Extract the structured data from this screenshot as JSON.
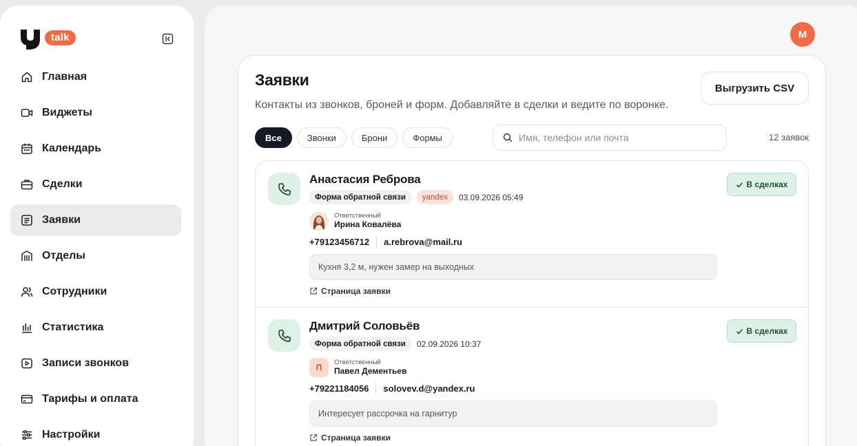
{
  "brand": {
    "logo_text": "talk",
    "accent": "#f26a45"
  },
  "sidebar": {
    "items": [
      {
        "label": "Главная",
        "icon": "home-icon",
        "active": false
      },
      {
        "label": "Виджеты",
        "icon": "video-icon",
        "active": false
      },
      {
        "label": "Календарь",
        "icon": "calendar-icon",
        "active": false
      },
      {
        "label": "Сделки",
        "icon": "briefcase-icon",
        "active": false
      },
      {
        "label": "Заявки",
        "icon": "list-icon",
        "active": true
      },
      {
        "label": "Отделы",
        "icon": "building-icon",
        "active": false
      },
      {
        "label": "Сотрудники",
        "icon": "users-icon",
        "active": false
      },
      {
        "label": "Статистика",
        "icon": "chart-icon",
        "active": false
      },
      {
        "label": "Записи звонков",
        "icon": "play-icon",
        "active": false
      },
      {
        "label": "Тарифы и оплата",
        "icon": "card-icon",
        "active": false
      },
      {
        "label": "Настройки",
        "icon": "sliders-icon",
        "active": false
      }
    ]
  },
  "header": {
    "user_initial": "М"
  },
  "page": {
    "title": "Заявки",
    "subtitle": "Контакты из звонков, броней и форм. Добавляйте в сделки и ведите по воронке.",
    "export_label": "Выгрузить CSV",
    "filters": [
      {
        "label": "Все",
        "active": true
      },
      {
        "label": "Звонки",
        "active": false
      },
      {
        "label": "Брони",
        "active": false
      },
      {
        "label": "Формы",
        "active": false
      }
    ],
    "search_placeholder": "Имя, телефон или почта",
    "count_label": "12 заявок"
  },
  "leads": [
    {
      "name": "Анастасия Реброва",
      "source": "Форма обратной связи",
      "utm": "yandex",
      "date": "03.09.2026 05:49",
      "responsible_label": "Ответственный",
      "responsible_name": "Ирина Ковалёва",
      "responsible_initial": "",
      "phone": "+79123456712",
      "email": "a.rebrova@mail.ru",
      "comment": "Кухня 3,2 м, нужен замер на выходных",
      "link_label": "Страница заявки",
      "status_label": "В сделках"
    },
    {
      "name": "Дмитрий Соловьёв",
      "source": "Форма обратной связи",
      "utm": "",
      "date": "02.09.2026 10:37",
      "responsible_label": "Ответственный",
      "responsible_name": "Павел Дементьев",
      "responsible_initial": "П",
      "phone": "+79221184056",
      "email": "solovev.d@yandex.ru",
      "comment": "Интересует рассрочка на гарнитур",
      "link_label": "Страница заявки",
      "status_label": "В сделках"
    }
  ]
}
